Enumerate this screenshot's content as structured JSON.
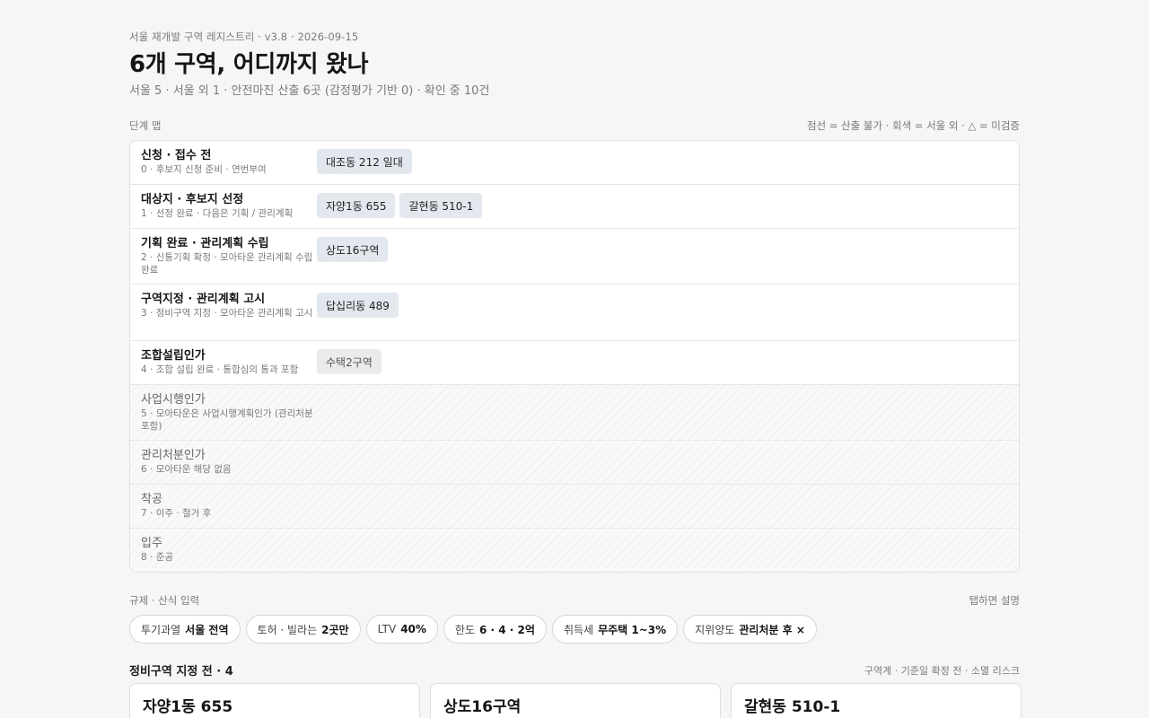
{
  "header": {
    "meta": "서울 재개발 구역 레지스트리 · v3.8 · 2026-09-15",
    "title": "6개 구역, 어디까지 왔나",
    "subtitle": "서울 5 · 서울 외 1 · 안전마진 산출 6곳 (감정평가 기반 0) · 확인 중 10건"
  },
  "stage_map": {
    "label": "단계 맵",
    "legend": "점선 = 산출 불가 · 회색 = 서울 외 · △ = 미검증",
    "rows": [
      {
        "name": "신청 · 접수 전",
        "desc": "0 · 후보지 신청 준비 · 연번부여",
        "chips": [
          {
            "label": "대조동 212 일대"
          }
        ]
      },
      {
        "name": "대상지 · 후보지 선정",
        "desc": "1 · 선정 완료 · 다음은 기획 / 관리계획",
        "chips": [
          {
            "label": "자양1동 655"
          },
          {
            "label": "갈현동 510-1"
          }
        ]
      },
      {
        "name": "기획 완료 · 관리계획 수립",
        "desc": "2 · 신통기획 확정 · 모아타운 관리계획 수립 완료",
        "chips": [
          {
            "label": "상도16구역"
          }
        ]
      },
      {
        "name": "구역지정 · 관리계획 고시",
        "desc": "3 · 정비구역 지정 · 모아타운 관리계획 고시",
        "chips": [
          {
            "label": "답십리동 489"
          }
        ]
      },
      {
        "name": "조합설립인가",
        "desc": "4 · 조합 설립 완료 · 통합심의 통과 포함",
        "chips": [
          {
            "label": "수택2구역",
            "muted": true
          }
        ]
      },
      {
        "name": "사업시행인가",
        "desc": "5 · 모아타운은 사업시행계획인가 (관리처분 포함)",
        "chips": []
      },
      {
        "name": "관리처분인가",
        "desc": "6 · 모아타운 해당 없음",
        "chips": []
      },
      {
        "name": "착공",
        "desc": "7 · 이주 · 철거 후",
        "chips": []
      },
      {
        "name": "입주",
        "desc": "8 · 준공",
        "chips": []
      }
    ]
  },
  "regulation": {
    "label": "규제 · 산식 입력",
    "hint": "탭하면 설명",
    "pills": [
      {
        "key": "투기과열",
        "value": "서울 전역"
      },
      {
        "key": "토허 · 빌라는",
        "value": "2곳만"
      },
      {
        "key": "LTV",
        "value": "40%"
      },
      {
        "key": "한도",
        "value": "6 · 4 · 2억"
      },
      {
        "key": "취득세",
        "value": "무주택 1~3%"
      },
      {
        "key": "지위양도",
        "value": "관리처분 후 ×"
      }
    ]
  },
  "pre_designation": {
    "label": "정비구역 지정 전 · 4",
    "hint": "구역계 · 기준일 확정 전 · 소멸 리스크",
    "cards": [
      {
        "name": "자양1동 655"
      },
      {
        "name": "상도16구역"
      },
      {
        "name": "갈현동 510-1"
      }
    ]
  }
}
